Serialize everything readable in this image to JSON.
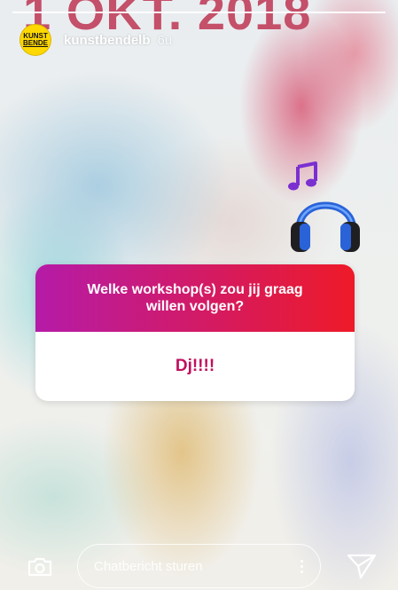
{
  "story": {
    "banner_text": "1 OKT. 2018",
    "progress": 1.0
  },
  "header": {
    "avatar_line1": "KUNST",
    "avatar_line2": "BENDE",
    "username": "kunstbendelb",
    "time": "6u"
  },
  "stickers": {
    "note_icon": "music-note-icon",
    "headphones_icon": "headphones-icon"
  },
  "question": {
    "prompt": "Welke workshop(s) zou jij graag willen volgen?",
    "answer": "Dj!!!!",
    "gradient_start": "#b51ba8",
    "gradient_end": "#ee1a28",
    "answer_color": "#c0105e"
  },
  "bottom_bar": {
    "chat_placeholder": "Chatbericht sturen",
    "camera_icon": "camera-icon",
    "more_icon": "more-vertical-icon",
    "send_icon": "send-icon"
  }
}
